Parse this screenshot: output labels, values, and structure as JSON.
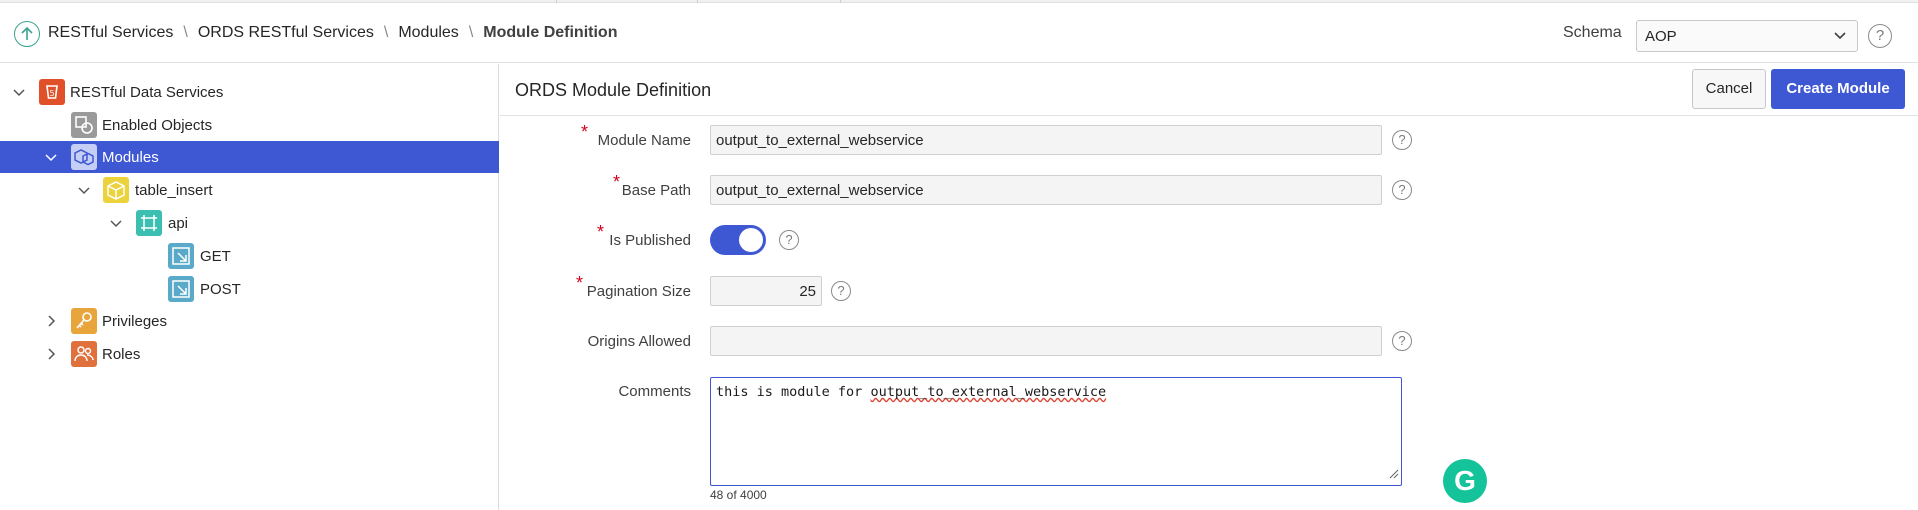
{
  "header": {
    "breadcrumbs": [
      "RESTful Services",
      "ORDS RESTful Services",
      "Modules",
      "Module Definition"
    ],
    "schema_label": "Schema",
    "schema_value": "AOP",
    "help_glyph": "?"
  },
  "sidebar": {
    "items": [
      {
        "label": "RESTful Data Services",
        "icon": "restful-data-services-icon",
        "color": "#e0512a"
      },
      {
        "label": "Enabled Objects",
        "icon": "enabled-objects-icon",
        "color": "#8f8f8f"
      },
      {
        "label": "Modules",
        "icon": "modules-icon",
        "color": "#ffffff"
      },
      {
        "label": "table_insert",
        "icon": "template-icon",
        "color": "#e8c832"
      },
      {
        "label": "api",
        "icon": "handler-icon",
        "color": "#3cbfb0"
      },
      {
        "label": "GET",
        "icon": "get-handler-icon",
        "color": "#5aa9c9"
      },
      {
        "label": "POST",
        "icon": "post-handler-icon",
        "color": "#5aa9c9"
      },
      {
        "label": "Privileges",
        "icon": "privileges-icon",
        "color": "#e8a53c"
      },
      {
        "label": "Roles",
        "icon": "roles-icon",
        "color": "#e0713c"
      }
    ]
  },
  "main": {
    "title": "ORDS Module Definition",
    "cancel_label": "Cancel",
    "create_label": "Create Module",
    "fields": {
      "module_name": {
        "label": "Module Name",
        "value": "output_to_external_webservice"
      },
      "base_path": {
        "label": "Base Path",
        "value": "output_to_external_webservice"
      },
      "is_published": {
        "label": "Is Published",
        "checked": true
      },
      "pagination_size": {
        "label": "Pagination Size",
        "value": "25"
      },
      "origins_allowed": {
        "label": "Origins Allowed",
        "value": ""
      },
      "comments": {
        "label": "Comments",
        "value_prefix": "this is module for ",
        "value_flagged": "output_to_external_webservice",
        "counter": "48 of 4000"
      }
    },
    "required_mark": "*"
  },
  "colors": {
    "accent": "#3e58d4",
    "required": "#d0021b",
    "grammarly": "#15c39a"
  }
}
